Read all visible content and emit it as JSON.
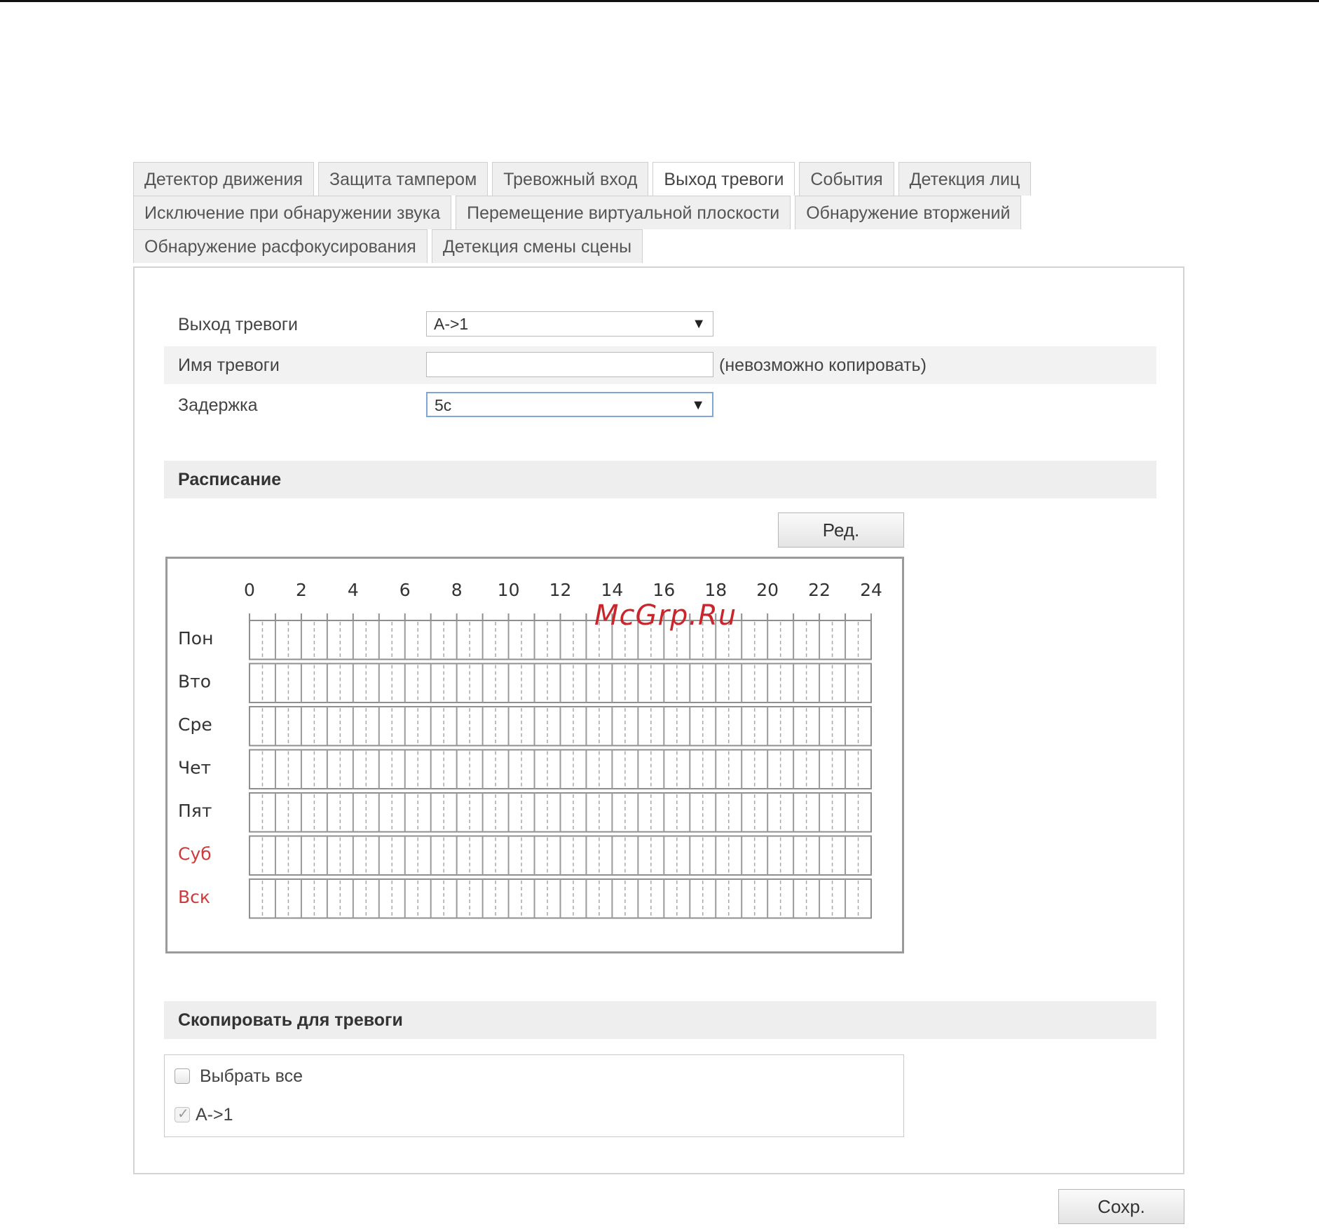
{
  "tabs": {
    "row1": [
      "Детектор движения",
      "Защита тампером",
      "Тревожный вход",
      "Выход тревоги",
      "События",
      "Детекция лиц"
    ],
    "row2": [
      "Исключение при обнаружении звука",
      "Перемещение виртуальной плоскости",
      "Обнаружение вторжений"
    ],
    "row3": [
      "Обнаружение расфокусирования",
      "Детекция смены сцены"
    ],
    "active": "Выход тревоги"
  },
  "form": {
    "alarm_output_label": "Выход тревоги",
    "alarm_output_value": "A->1",
    "alarm_name_label": "Имя тревоги",
    "alarm_name_value": "",
    "alarm_name_note": "(невозможно копировать)",
    "delay_label": "Задержка",
    "delay_value": "5с"
  },
  "schedule": {
    "section_title": "Расписание",
    "edit_button": "Ред.",
    "hours": [
      "0",
      "2",
      "4",
      "6",
      "8",
      "10",
      "12",
      "14",
      "16",
      "18",
      "20",
      "22",
      "24"
    ],
    "days": [
      {
        "label": "Пон",
        "weekend": false
      },
      {
        "label": "Вто",
        "weekend": false
      },
      {
        "label": "Сре",
        "weekend": false
      },
      {
        "label": "Чет",
        "weekend": false
      },
      {
        "label": "Пят",
        "weekend": false
      },
      {
        "label": "Суб",
        "weekend": true
      },
      {
        "label": "Вск",
        "weekend": true
      }
    ],
    "weekend_color": "#d03a3a"
  },
  "copy": {
    "section_title": "Скопировать для тревоги",
    "select_all_label": "Выбрать все",
    "select_all_checked": false,
    "item_label": "A->1",
    "item_checked": true
  },
  "save_button": "Сохр.",
  "watermark": "McGrp.Ru"
}
